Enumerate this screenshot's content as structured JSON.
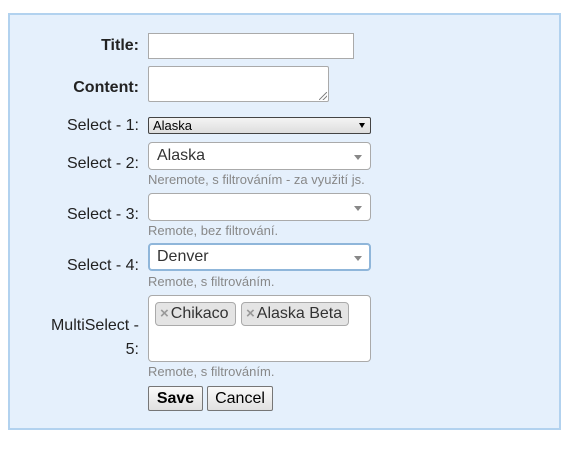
{
  "form": {
    "title": {
      "label": "Title:",
      "value": ""
    },
    "content": {
      "label": "Content:",
      "value": ""
    },
    "select1": {
      "label": "Select - 1:",
      "value": "Alaska"
    },
    "select2": {
      "label": "Select - 2:",
      "value": "Alaska",
      "help": "Neremote, s filtrováním - za využití js."
    },
    "select3": {
      "label": "Select - 3:",
      "value": "",
      "help": "Remote, bez filtrování."
    },
    "select4": {
      "label": "Select - 4:",
      "value": "Denver",
      "help": "Remote, s filtrováním."
    },
    "multiselect5": {
      "label_line1": "MultiSelect -",
      "label_line2": "5:",
      "remove_glyph": "×",
      "tags": [
        "Chikaco",
        "Alaska Beta"
      ],
      "help": "Remote, s filtrováním."
    }
  },
  "actions": {
    "save_label": "Save",
    "cancel_label": "Cancel"
  },
  "colors": {
    "panel_bg": "#e5f0fc",
    "panel_border": "#b2d2ef",
    "focus_border": "#8fb6da"
  }
}
